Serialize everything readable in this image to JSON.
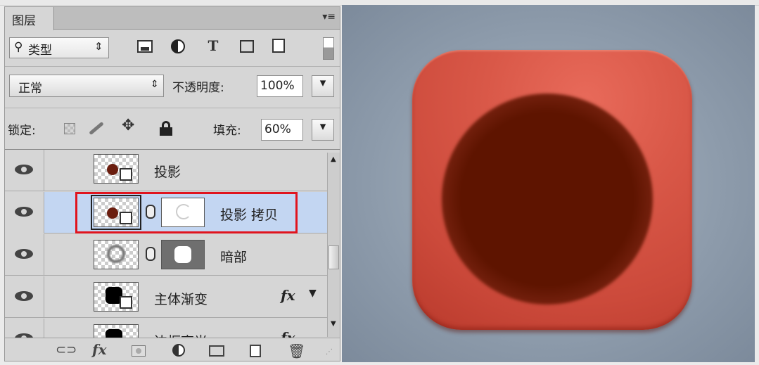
{
  "panel": {
    "tab_label": "图层",
    "menu_icon": "panel-menu-icon"
  },
  "filter": {
    "kind_label": "类型",
    "kind_arrows": "⇕",
    "icons": [
      "image-filter-icon",
      "adjustment-filter-icon",
      "type-filter-icon",
      "shape-filter-icon",
      "smart-object-filter-icon"
    ],
    "type_glyph": "T"
  },
  "blend": {
    "mode": "正常",
    "mode_arrows": "⇕",
    "opacity_label": "不透明度:",
    "opacity_value": "100%",
    "dropdown_glyph": "▾"
  },
  "lock": {
    "label": "锁定:",
    "fill_label": "填充:",
    "fill_value": "60%"
  },
  "layers": [
    {
      "name": "投影",
      "selected": false,
      "has_mask": false,
      "fx": ""
    },
    {
      "name": "投影 拷贝",
      "selected": true,
      "has_mask": true,
      "fx": ""
    },
    {
      "name": "暗部",
      "selected": false,
      "has_mask": true,
      "fx": ""
    },
    {
      "name": "主体渐变",
      "selected": false,
      "has_mask": false,
      "fx": "fx"
    },
    {
      "name": "边框高光",
      "selected": false,
      "has_mask": false,
      "fx": "fx"
    }
  ],
  "bottom_bar": {
    "fx_label": "fx",
    "icons": [
      "link-layers-icon",
      "fx-icon",
      "add-mask-icon",
      "adjustment-layer-icon",
      "new-group-icon",
      "new-layer-icon",
      "delete-icon"
    ]
  },
  "colors": {
    "selection_outline": "#e0141e",
    "tile_red": "#d45545",
    "hole_dark": "#5e1400",
    "background_slate": "#8d9bab",
    "selected_row": "#c3d6f2"
  }
}
